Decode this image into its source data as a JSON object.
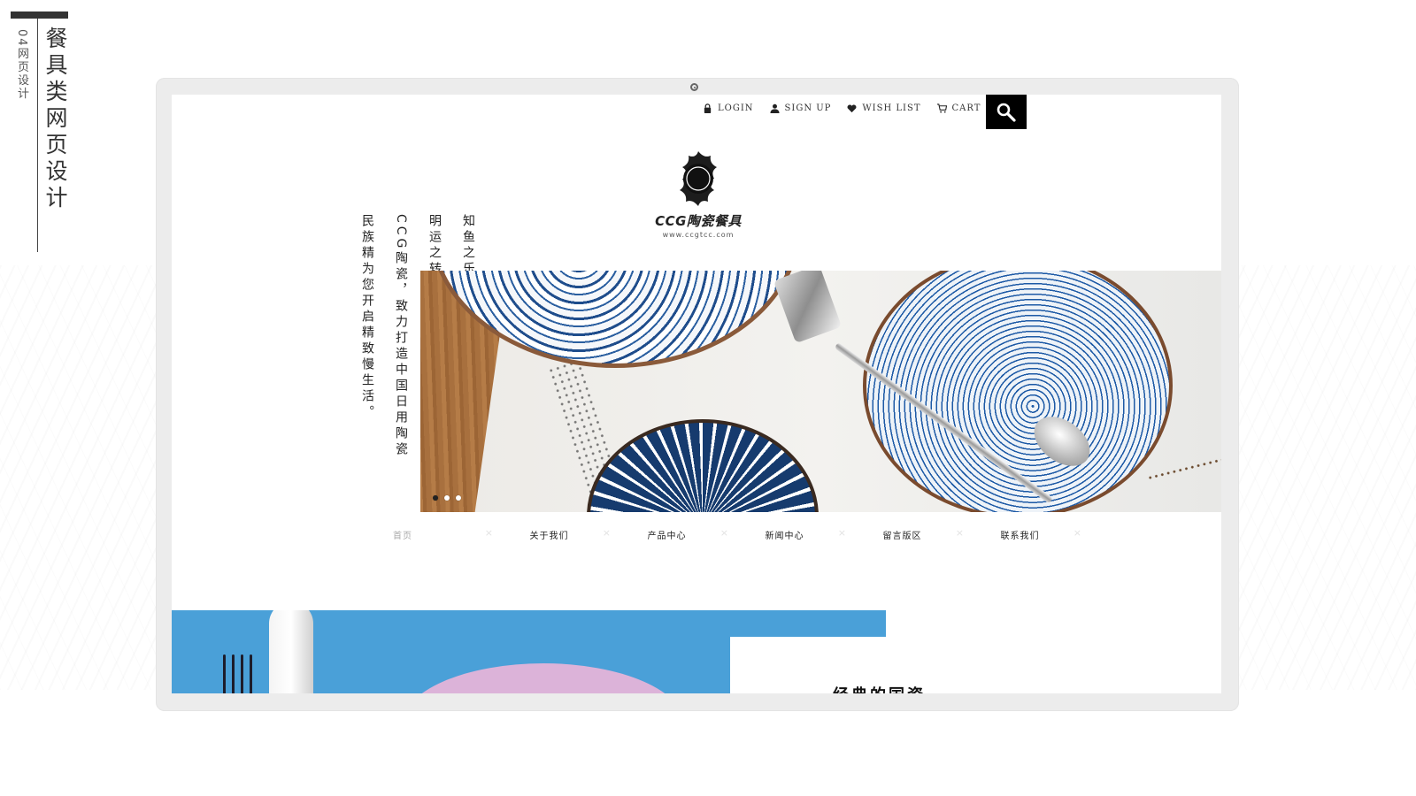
{
  "slide": {
    "title": "餐具类网页设计",
    "subtitle": "04网页设计"
  },
  "site": {
    "top_links": [
      {
        "label": "LOGIN",
        "icon": "lock-icon"
      },
      {
        "label": "SIGN UP",
        "icon": "user-icon"
      },
      {
        "label": "WISH LIST",
        "icon": "heart-icon"
      },
      {
        "label": "CART",
        "icon": "cart-icon"
      }
    ],
    "search_icon": "search-icon",
    "logo": {
      "name": "CCG陶瓷餐具",
      "url": "www.ccgtcc.com"
    },
    "slogans": [
      "知鱼之乐，在于食；",
      "明运之转，在于器。",
      "CCG陶瓷，致力打造中国日用陶瓷",
      "民族精为您开启精致慢生活。"
    ],
    "hero": {
      "slides_count": 3,
      "active_slide": 1
    },
    "nav": [
      "首页",
      "关于我们",
      "产品中心",
      "新闻中心",
      "留言版区",
      "联系我们"
    ],
    "section2": {
      "title": "经典的国瓷"
    }
  },
  "colors": {
    "accent": "#000000",
    "banner_blue": "#4aa0d8",
    "porcelain_blue": "#1d5aa6"
  }
}
